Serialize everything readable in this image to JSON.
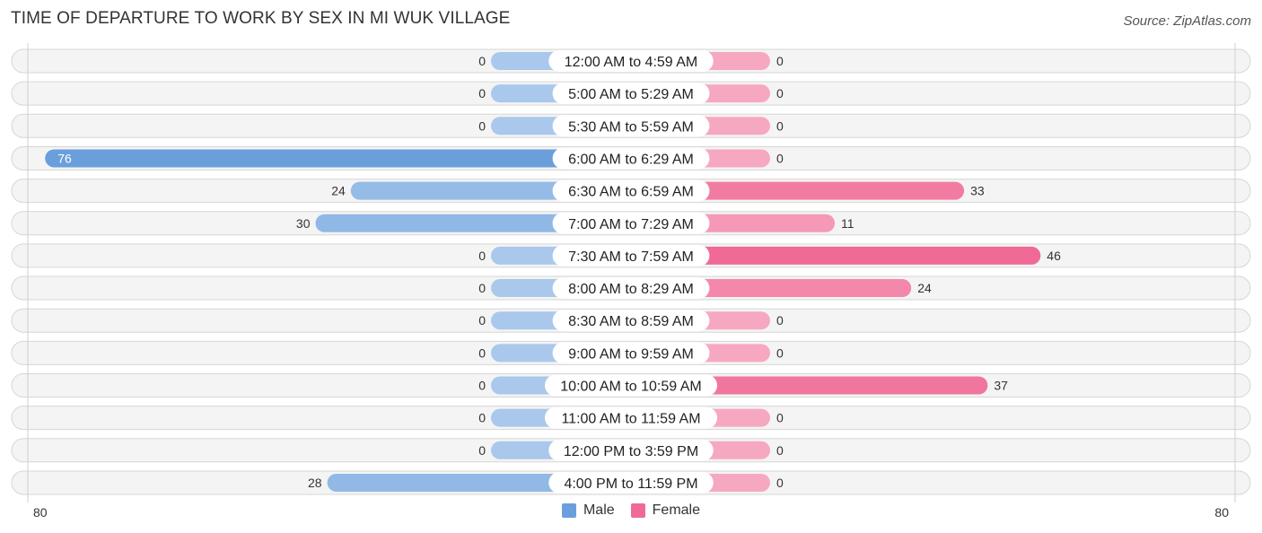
{
  "header": {
    "title": "TIME OF DEPARTURE TO WORK BY SEX IN MI WUK VILLAGE",
    "source": "Source: ZipAtlas.com"
  },
  "colors": {
    "male": "#6a9fdc",
    "male_light": "#a9c8ec",
    "female": "#f06a95",
    "female_light": "#f7a8c1"
  },
  "chart_data": {
    "type": "bar",
    "orientation": "horizontal-diverging",
    "title": "TIME OF DEPARTURE TO WORK BY SEX IN MI WUK VILLAGE",
    "categories": [
      "12:00 AM to 4:59 AM",
      "5:00 AM to 5:29 AM",
      "5:30 AM to 5:59 AM",
      "6:00 AM to 6:29 AM",
      "6:30 AM to 6:59 AM",
      "7:00 AM to 7:29 AM",
      "7:30 AM to 7:59 AM",
      "8:00 AM to 8:29 AM",
      "8:30 AM to 8:59 AM",
      "9:00 AM to 9:59 AM",
      "10:00 AM to 10:59 AM",
      "11:00 AM to 11:59 AM",
      "12:00 PM to 3:59 PM",
      "4:00 PM to 11:59 PM"
    ],
    "series": [
      {
        "name": "Male",
        "values": [
          0,
          0,
          0,
          76,
          24,
          30,
          0,
          0,
          0,
          0,
          0,
          0,
          0,
          28
        ]
      },
      {
        "name": "Female",
        "values": [
          0,
          0,
          0,
          0,
          33,
          11,
          46,
          24,
          0,
          0,
          37,
          0,
          0,
          0
        ]
      }
    ],
    "axis": {
      "left_label": "80",
      "right_label": "80",
      "range": [
        0,
        80
      ]
    },
    "legend": {
      "position": "bottom-center",
      "entries": [
        "Male",
        "Female"
      ]
    },
    "xlabel": "",
    "ylabel": ""
  }
}
